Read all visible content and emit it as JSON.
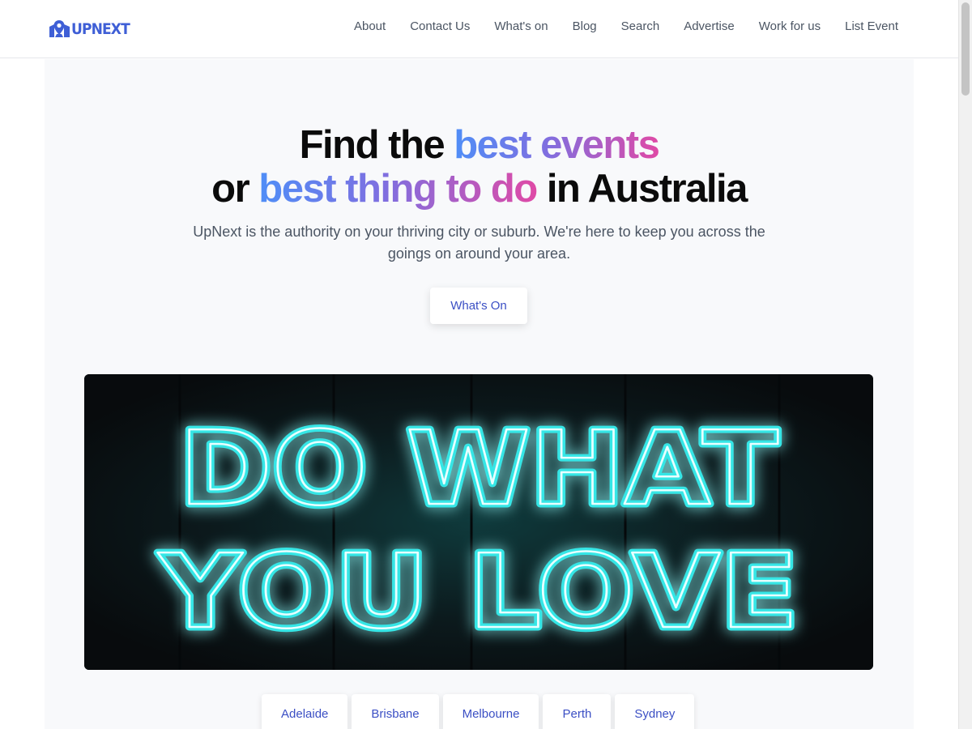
{
  "brand": {
    "name": "UPNEXT",
    "icon": "map-pin-icon",
    "color": "#3f5fd6"
  },
  "nav": {
    "items": [
      {
        "label": "About"
      },
      {
        "label": "Contact Us"
      },
      {
        "label": "What's on"
      },
      {
        "label": "Blog"
      },
      {
        "label": "Search"
      },
      {
        "label": "Advertise"
      },
      {
        "label": "Work for us"
      },
      {
        "label": "List Event"
      }
    ]
  },
  "hero": {
    "title_line1_plain": "Find the ",
    "title_line1_accent": "best events",
    "title_line2_plain_start": "or ",
    "title_line2_accent": "best thing to do",
    "title_line2_plain_end": " in Australia",
    "subtitle": "UpNext is the authority on your thriving city or suburb. We're here to keep you across the goings on around your area.",
    "cta_label": "What's On"
  },
  "banner": {
    "line1": "DO WHAT",
    "line2": "YOU LOVE",
    "neon_color": "#35e6e6"
  },
  "cities": [
    {
      "label": "Adelaide"
    },
    {
      "label": "Brisbane"
    },
    {
      "label": "Melbourne"
    },
    {
      "label": "Perth"
    },
    {
      "label": "Sydney"
    }
  ],
  "colors": {
    "accent_gradient": [
      "#4f8ef7",
      "#7f6fe0",
      "#df4aa6"
    ],
    "link": "#3b4fc4"
  }
}
